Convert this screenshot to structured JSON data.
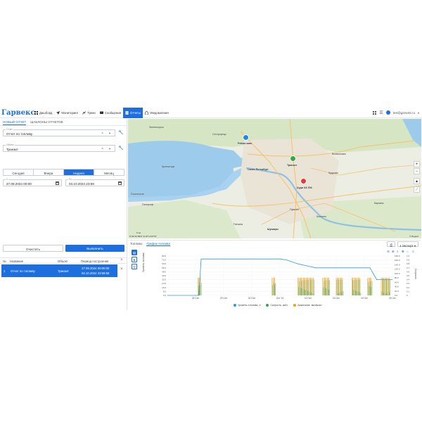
{
  "header": {
    "logo": "Гарвекс",
    "nav": [
      {
        "label": "Дашборд",
        "icon": "dashboard-icon"
      },
      {
        "label": "Мониторинг",
        "icon": "navigation-arrow-icon"
      },
      {
        "label": "Треки",
        "icon": "tracks-icon"
      },
      {
        "label": "Сообщения",
        "icon": "messages-icon"
      },
      {
        "label": "Отчеты",
        "icon": "report-icon",
        "active": true
      },
      {
        "label": "Уведомления",
        "icon": "notification-icon"
      }
    ],
    "user": "test@garveks.ru"
  },
  "left": {
    "tabs": [
      "НОВЫЙ ОТЧЕТ",
      "ШАБЛОНЫ ОТЧЕТОВ"
    ],
    "report": {
      "label": "Отчет",
      "value": "Отчет по топливу"
    },
    "object": {
      "label": "Объект",
      "value": "Транзит"
    },
    "periods": [
      "Сегодня",
      "Вчера",
      "Неделя",
      "Месяц"
    ],
    "active_period": "Неделя",
    "from": {
      "label": "С",
      "value": "27.09.2024 00:00"
    },
    "to": {
      "label": "По",
      "value": "04.10.2024 23:59"
    },
    "clear": "Очистить",
    "run": "Выполнить",
    "table": {
      "headers": [
        "№",
        "Название",
        "Объект",
        "Период построения"
      ],
      "rows": [
        {
          "num": "1",
          "name": "Отчет по топливу",
          "object": "Транзит",
          "period_from": "27.09.2024 00:00:00",
          "period_to": "04.10.2024 23:59:59"
        }
      ]
    }
  },
  "map": {
    "labels": {
      "city": "Санкт-Петербург",
      "kronshtadt": "Кронштадт",
      "kolpino": "Колпино",
      "shushary": "Шушары",
      "pushkin": "Пушкин",
      "gatchina": "Гатчина",
      "kirovsk": "Кировск",
      "vsevolozhsk": "Всеволожск",
      "sestroretsk": "Сестрорецк",
      "petergof": "Петергоф",
      "lomonosov": "Ломоносов",
      "zelenogorsk": "Зеленогорск",
      "kudrovo": "Кудрово"
    },
    "vehicles": [
      {
        "name": "Peklas azas",
        "color": "#1e88e5"
      },
      {
        "name": "Транзит",
        "color": "#2eaa4a"
      },
      {
        "name": "Ауди A6 304",
        "color": "#e53935"
      }
    ],
    "scale": "5 км",
    "coords": "N 59°46.6837'  E 30°13.8778'",
    "copyright": "© Яндекс"
  },
  "bottom": {
    "tabs": [
      "Топливо",
      "График топлива"
    ],
    "active_tab": "График топлива",
    "export": "Экспорт",
    "y_left_title": "Уровень топлива",
    "y_right_title": "Скорость"
  },
  "chart_data": {
    "type": "line",
    "x_ticks": [
      "28 Сен",
      "29 Сен",
      "30 Сен",
      "Окт '24",
      "02 Окт",
      "03 Окт",
      "04 Окт",
      "05 Окт"
    ],
    "y_left_ticks": [
      "0.0",
      "8.0",
      "16.0",
      "24.0",
      "32.0",
      "40.0",
      "48.0",
      "56.0",
      "64.0",
      "72.0",
      "80.0"
    ],
    "y_right_ticks": [
      "0.0",
      "20.0",
      "40.0",
      "60.0",
      "80.0",
      "100.0",
      "120.0",
      "140.0",
      "160.0",
      "180.0"
    ],
    "y_right2_ticks": [
      "0",
      "0.1",
      "0.2",
      "0.3",
      "0.4",
      "0.5",
      "0.6",
      "0.7",
      "0.8",
      "0.9",
      "1.0"
    ],
    "ylim_left": [
      0,
      80
    ],
    "ylim_right": [
      0,
      180
    ],
    "series": [
      {
        "name": "Уровень топлива, л",
        "color": "#2e9bd6",
        "points": [
          [
            0,
            0
          ],
          [
            0.14,
            0
          ],
          [
            0.15,
            74
          ],
          [
            0.5,
            74
          ],
          [
            0.53,
            72
          ],
          [
            0.58,
            64
          ],
          [
            0.62,
            60
          ],
          [
            0.66,
            56
          ],
          [
            0.9,
            56
          ],
          [
            0.93,
            32
          ],
          [
            1.0,
            32
          ]
        ]
      },
      {
        "name": "Скорость, км/ч",
        "color": "#3aa35a"
      },
      {
        "name": "Зажигание, вкл/выкл",
        "color": "#f0a01c"
      }
    ]
  }
}
